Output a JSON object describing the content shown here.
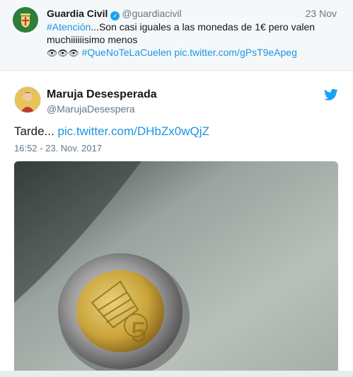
{
  "quoted_tweet": {
    "name": "Guardia Civil",
    "handle": "@guardiacivil",
    "date": "23 Nov",
    "hashtag": "#Atención",
    "text_line1": "...Son casi iguales a las monedas de 1€ pero valen",
    "text_line2": "muchiiiiiisimo menos",
    "eyes": "👁👁👁",
    "hashtag2": "#QueNoTeLaCuelen",
    "link": "pic.twitter.com/gPsT9eApeg"
  },
  "tweet": {
    "name": "Maruja Desesperada",
    "handle": "@MarujaDesespera",
    "text": "Tarde...",
    "link": "pic.twitter.com/DHbZx0wQjZ",
    "timestamp": "16:52 - 23. Nov. 2017"
  },
  "icons": {
    "verified": "verified-badge-icon",
    "twitter": "twitter-bird-icon"
  },
  "colors": {
    "link": "#1b95e0",
    "muted": "#657786",
    "quote_bg": "#f5f8fa"
  }
}
